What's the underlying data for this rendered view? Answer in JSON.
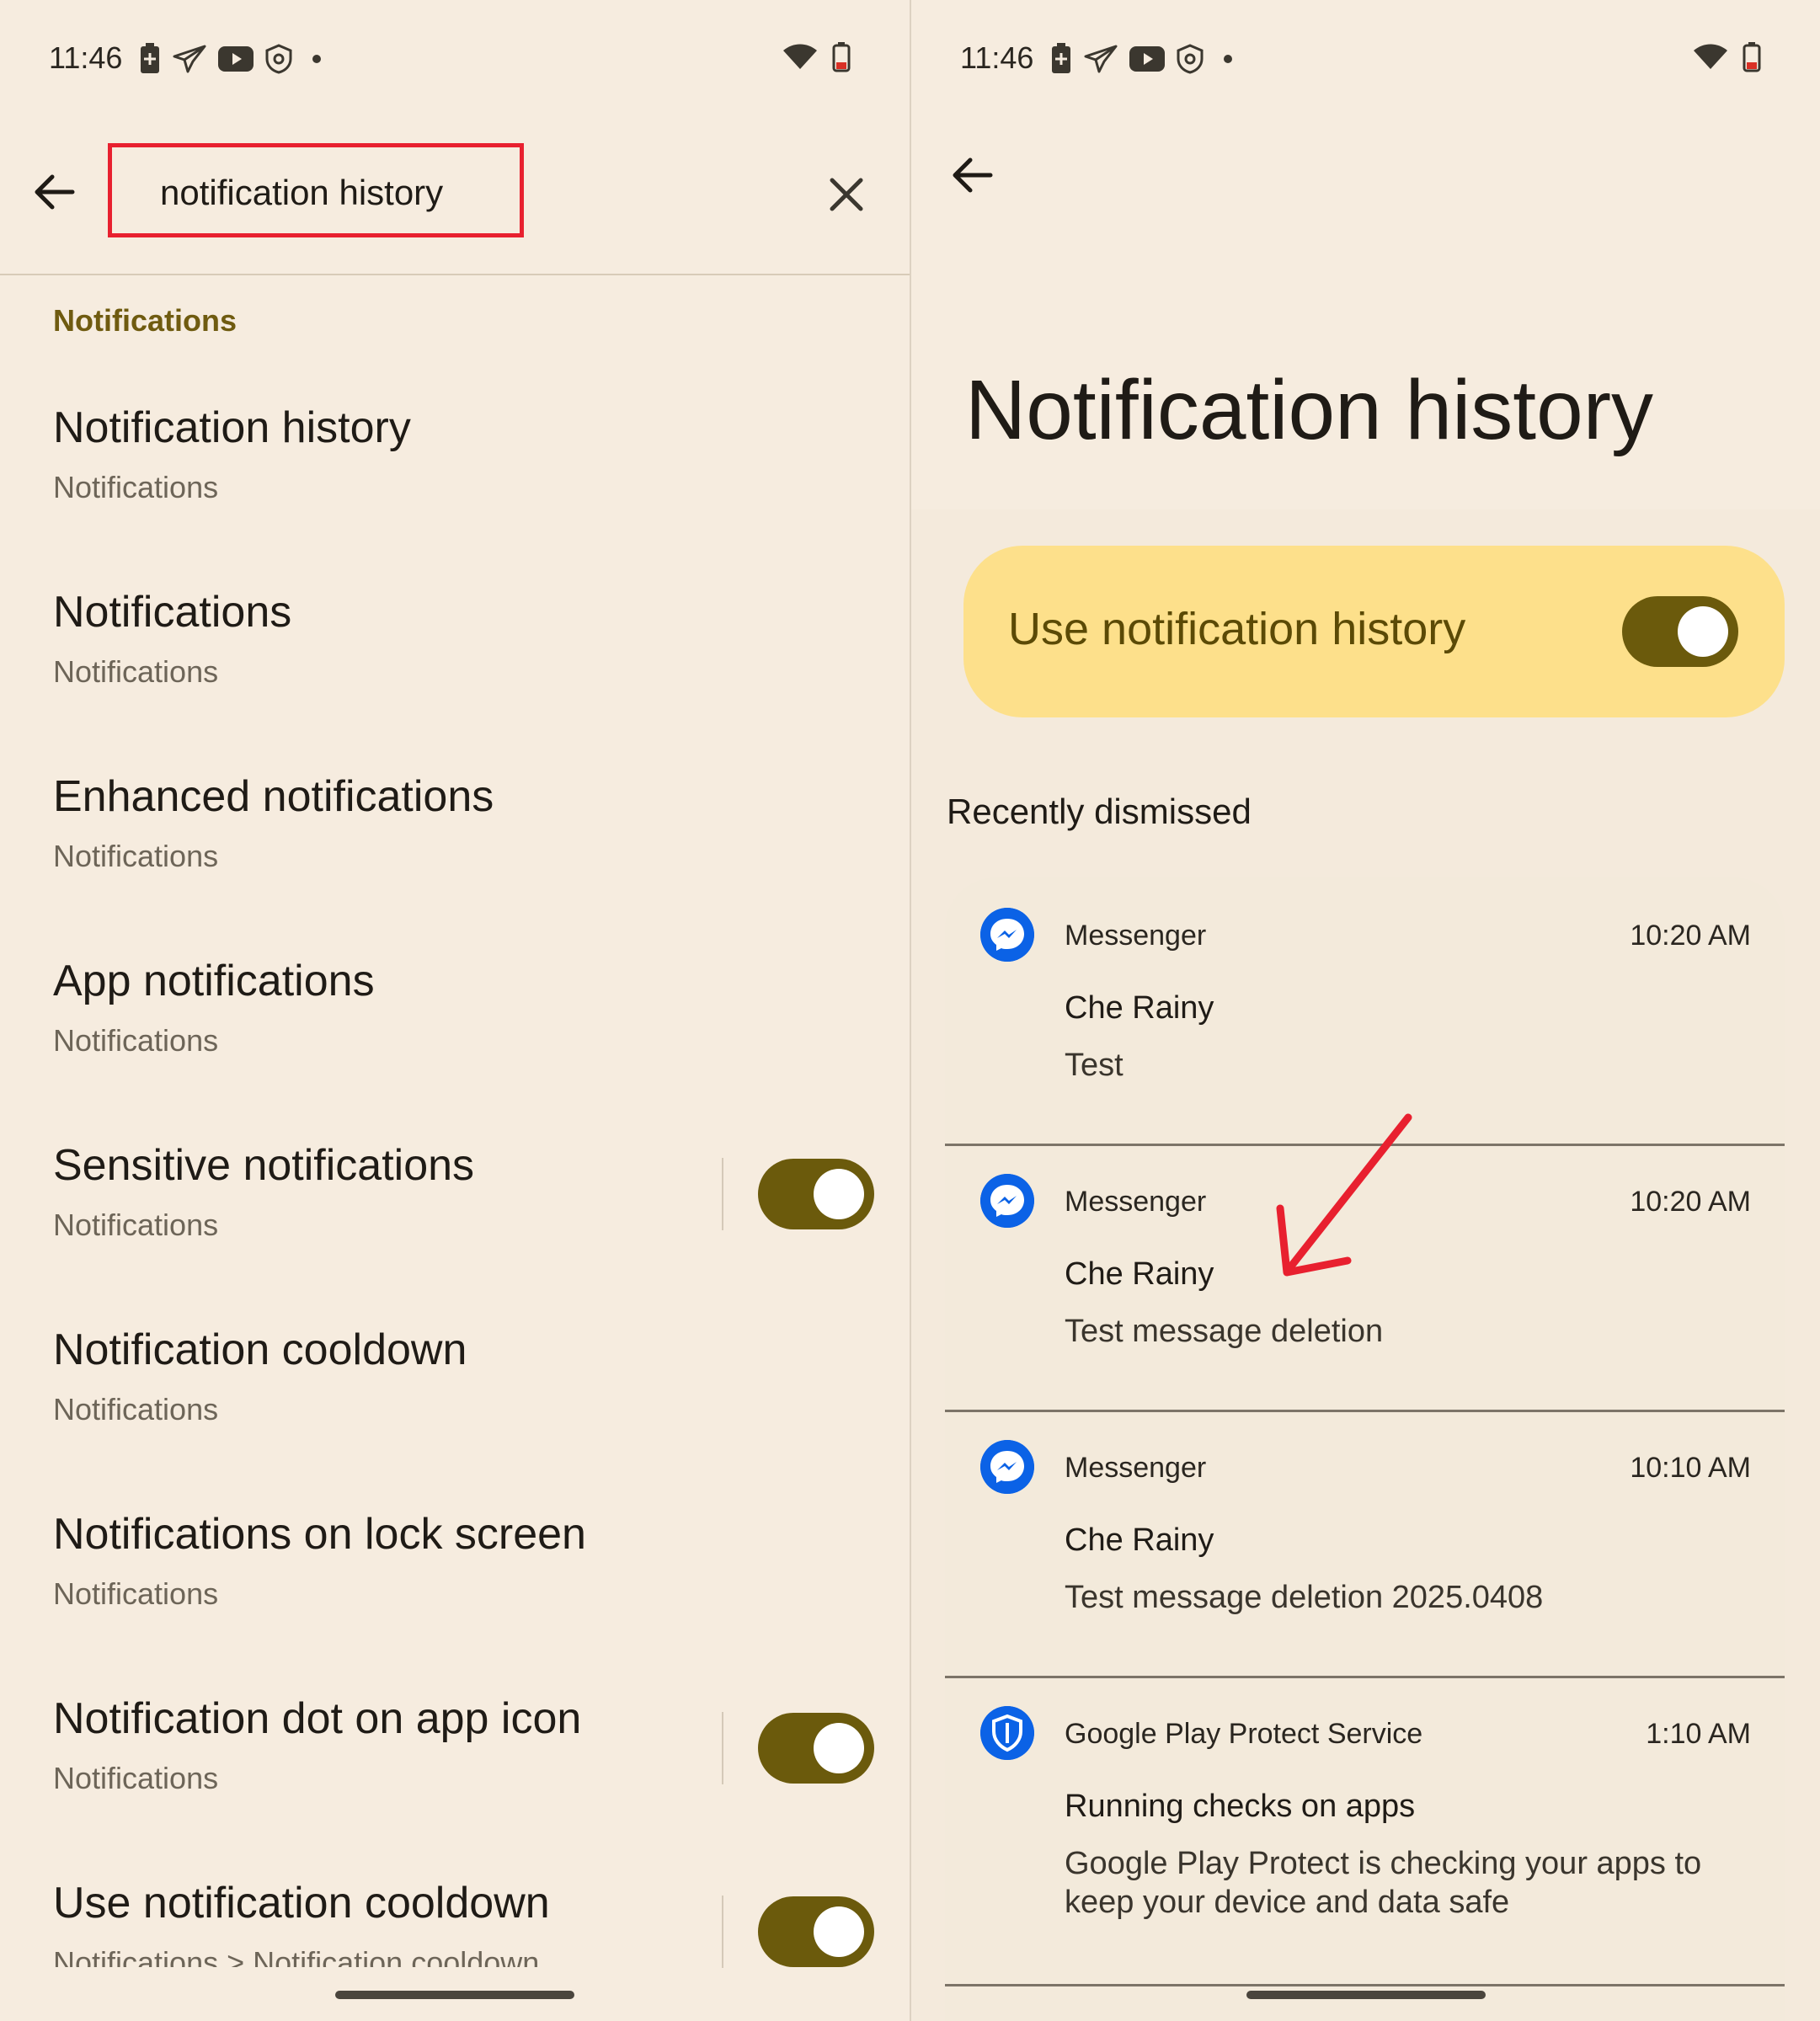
{
  "status_bar": {
    "time": "11:46",
    "icons": [
      "battery-saver-icon",
      "send-icon",
      "youtube-icon",
      "vpn-shield-icon",
      "dot-icon"
    ],
    "right_icons": [
      "wifi-icon",
      "battery-low-icon"
    ]
  },
  "left": {
    "search": {
      "query": "notification history"
    },
    "section_label": "Notifications",
    "results": [
      {
        "title": "Notification history",
        "subtitle": "Notifications",
        "has_toggle": false
      },
      {
        "title": "Notifications",
        "subtitle": "Notifications",
        "has_toggle": false
      },
      {
        "title": "Enhanced notifications",
        "subtitle": "Notifications",
        "has_toggle": false
      },
      {
        "title": "App notifications",
        "subtitle": "Notifications",
        "has_toggle": false
      },
      {
        "title": "Sensitive notifications",
        "subtitle": "Notifications",
        "has_toggle": true,
        "toggle_on": true
      },
      {
        "title": "Notification cooldown",
        "subtitle": "Notifications",
        "has_toggle": false
      },
      {
        "title": "Notifications on lock screen",
        "subtitle": "Notifications",
        "has_toggle": false
      },
      {
        "title": "Notification dot on app icon",
        "subtitle": "Notifications",
        "has_toggle": true,
        "toggle_on": true
      },
      {
        "title": "Use notification cooldown",
        "subtitle": "Notifications > Notification cooldown",
        "has_toggle": true,
        "toggle_on": true
      }
    ]
  },
  "right": {
    "page_title": "Notification history",
    "use_history": {
      "label": "Use notification history",
      "toggle_on": true
    },
    "recent_label": "Recently dismissed",
    "notifications": [
      {
        "app": "Messenger",
        "time": "10:20 AM",
        "title": "Che Rainy",
        "text": "Test",
        "icon": "messenger-icon"
      },
      {
        "app": "Messenger",
        "time": "10:20 AM",
        "title": "Che Rainy",
        "text": "Test message deletion",
        "icon": "messenger-icon"
      },
      {
        "app": "Messenger",
        "time": "10:10 AM",
        "title": "Che Rainy",
        "text": "Test message deletion 2025.0408",
        "icon": "messenger-icon"
      },
      {
        "app": "Google Play Protect Service",
        "time": "1:10 AM",
        "title": "Running checks on apps",
        "text": "Google Play Protect is checking your apps to keep your device and data safe",
        "icon": "play-protect-icon"
      }
    ]
  },
  "colors": {
    "background": "#f6ecdf",
    "accent": "#6b5a0c",
    "card_yellow": "#fde08b",
    "highlight_red": "#e8202f",
    "messenger_blue": "#0b62e6"
  }
}
